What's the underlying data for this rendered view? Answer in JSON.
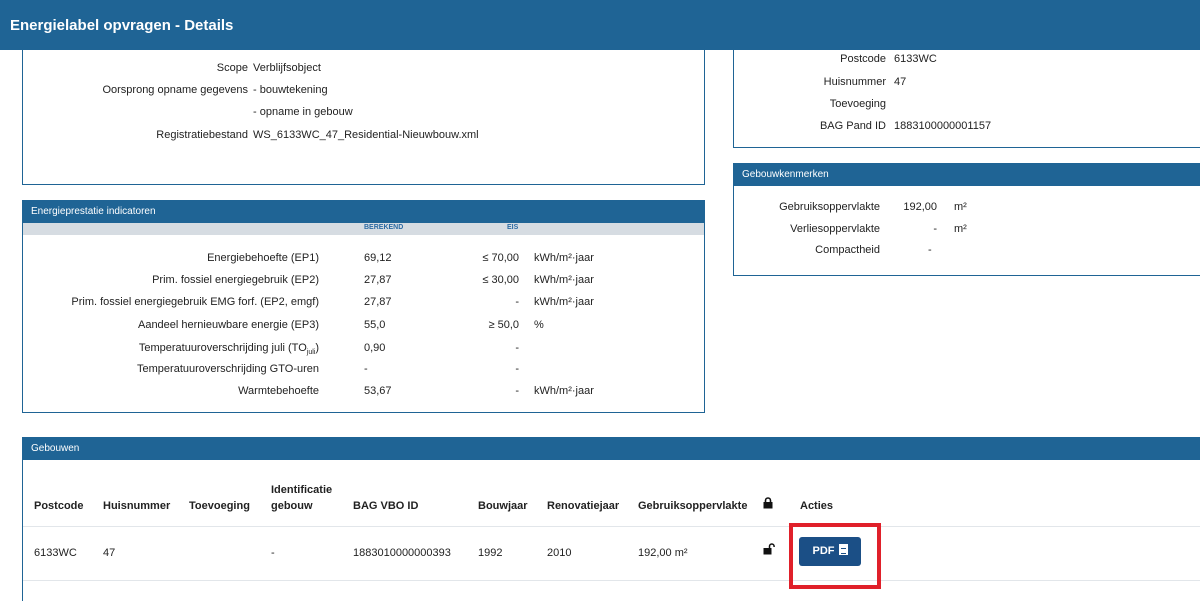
{
  "header": {
    "title": "Energielabel opvragen - Details"
  },
  "details": {
    "scope_label": "Scope",
    "scope_value": "Verblijfsobject",
    "origin_label": "Oorsprong opname gegevens",
    "origin_value_1": "- bouwtekening",
    "origin_value_2": "- opname in gebouw",
    "file_label": "Registratiebestand",
    "file_value": "WS_6133WC_47_Residential-Nieuwbouw.xml"
  },
  "address": {
    "postcode_label": "Postcode",
    "postcode_value": "6133WC",
    "huisnummer_label": "Huisnummer",
    "huisnummer_value": "47",
    "toevoeging_label": "Toevoeging",
    "toevoeging_value": "",
    "bag_label": "BAG Pand ID",
    "bag_value": "1883100000001157"
  },
  "kenmerken": {
    "title": "Gebouwkenmerken",
    "gebruik_label": "Gebruiksoppervlakte",
    "gebruik_value": "192,00",
    "gebruik_unit": "m²",
    "verlies_label": "Verliesoppervlakte",
    "verlies_value": "-",
    "verlies_unit": "m²",
    "compact_label": "Compactheid",
    "compact_value": "-"
  },
  "energy": {
    "title": "Energieprestatie indicatoren",
    "col_calc": "BEREKEND",
    "col_req": "EIS",
    "rows": [
      {
        "label": "Energiebehoefte (EP1)",
        "calc": "69,12",
        "req": "≤ 70,00",
        "unit": "kWh/m²·jaar"
      },
      {
        "label": "Prim. fossiel energiegebruik (EP2)",
        "calc": "27,87",
        "req": "≤ 30,00",
        "unit": "kWh/m²·jaar"
      },
      {
        "label": "Prim. fossiel energiegebruik EMG forf. (EP2, emgf)",
        "calc": "27,87",
        "req": "-",
        "unit": "kWh/m²·jaar"
      },
      {
        "label": "Aandeel hernieuwbare energie (EP3)",
        "calc": "55,0",
        "req": "≥ 50,0",
        "unit": "%"
      },
      {
        "label": "Temperatuuroverschrijding juli (TO",
        "label_sub": "juli",
        "label_end": ")",
        "calc": "0,90",
        "req": "-",
        "unit": ""
      },
      {
        "label": "Temperatuuroverschrijding GTO-uren",
        "calc": "-",
        "req": "-",
        "unit": ""
      },
      {
        "label": "Warmtebehoefte",
        "calc": "53,67",
        "req": "-",
        "unit": "kWh/m²·jaar"
      }
    ]
  },
  "buildings": {
    "title": "Gebouwen",
    "headers": {
      "postcode": "Postcode",
      "huisnummer": "Huisnummer",
      "toevoeging": "Toevoeging",
      "ident_1": "Identificatie",
      "ident_2": "gebouw",
      "bag": "BAG VBO ID",
      "bouwjaar": "Bouwjaar",
      "renovatie": "Renovatiejaar",
      "gebruik": "Gebruiksoppervlakte",
      "lock_icon": "lock-icon",
      "acties": "Acties"
    },
    "row": {
      "postcode": "6133WC",
      "huisnummer": "47",
      "toevoeging": "",
      "ident": "-",
      "bag": "1883010000000393",
      "bouwjaar": "1992",
      "renovatie": "2010",
      "gebruik": "192,00 m²",
      "unlock_icon": "unlock-icon",
      "pdf_label": "PDF",
      "pdf_icon": "document-icon"
    }
  },
  "colors": {
    "header_blue": "#1f6495",
    "button_blue": "#1b4f86",
    "highlight_red": "#e0202a",
    "subhead_grey": "#d6dce2"
  }
}
